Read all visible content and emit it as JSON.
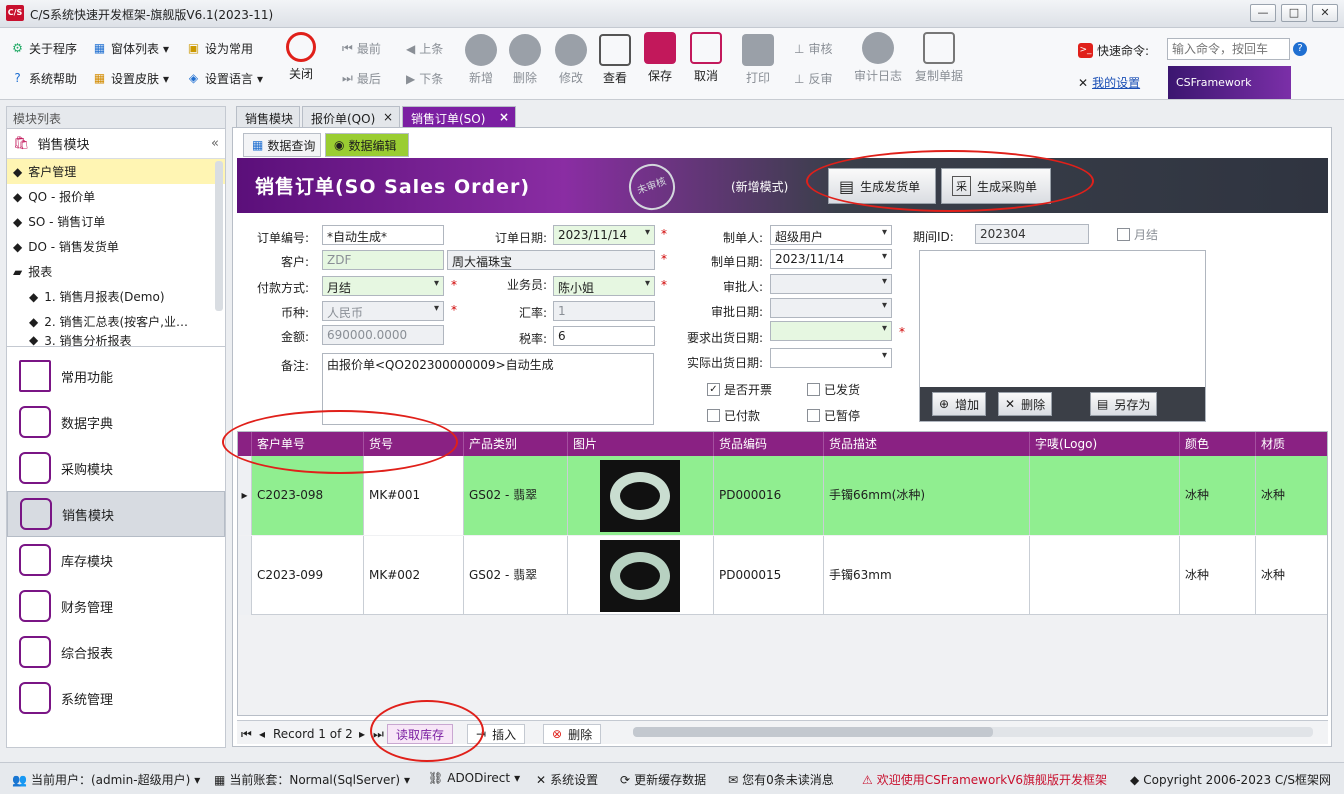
{
  "window": {
    "title": "C/S系统快速开发框架-旗舰版V6.1(2023-11)",
    "app_icon": "C/S",
    "minimize": "—",
    "maximize": "□",
    "close": "✕"
  },
  "ribbon": {
    "about": "关于程序",
    "window_list": "窗体列表",
    "set_common": "设为常用",
    "help": "系统帮助",
    "skin": "设置皮肤",
    "language": "设置语言",
    "close": "关闭",
    "first": "最前",
    "prev": "上条",
    "last": "最后",
    "next": "下条",
    "add": "新增",
    "delete": "删除",
    "modify": "修改",
    "view": "查看",
    "save": "保存",
    "cancel": "取消",
    "print": "打印",
    "approve": "审核",
    "unapprove": "反审",
    "audit_log": "审计日志",
    "copy": "复制单据",
    "quick_cmd_label": "快速命令:",
    "quick_cmd_placeholder": "输入命令，按回车",
    "my_settings": "我的设置",
    "logo_text": "CSFramework"
  },
  "sidebar": {
    "header": "模块列表",
    "module": "销售模块",
    "tree": [
      "客户管理",
      "QO - 报价单",
      "SO - 销售订单",
      "DO - 销售发货单",
      "报表",
      "1. 销售月报表(Demo)",
      "2. 销售汇总表(按客户,业…",
      "3. 销售分析报表"
    ],
    "nav": [
      "常用功能",
      "数据字典",
      "采购模块",
      "销售模块",
      "库存模块",
      "财务管理",
      "综合报表",
      "系统管理"
    ]
  },
  "tabs": [
    "销售模块",
    "报价单(QO)",
    "销售订单(SO)"
  ],
  "subtabs": [
    "数据查询",
    "数据编辑"
  ],
  "banner": {
    "title": "销售订单(SO Sales Order)",
    "stamp": "未审核",
    "mode": "(新增模式)",
    "btn_delivery": "生成发货单",
    "btn_purchase": "生成采购单",
    "btn_delivery_icon": "▤",
    "btn_purchase_icon": "采"
  },
  "form": {
    "order_no_label": "订单编号:",
    "order_no": "*自动生成*",
    "order_date_label": "订单日期:",
    "order_date": "2023/11/14",
    "maker_label": "制单人:",
    "maker": "超级用户",
    "period_label": "期间ID:",
    "period": "202304",
    "monthly_label": "月结",
    "customer_label": "客户:",
    "customer_code": "ZDF",
    "customer_name": "周大福珠宝",
    "make_date_label": "制单日期:",
    "make_date": "2023/11/14",
    "pay_label": "付款方式:",
    "pay": "月结",
    "sales_label": "业务员:",
    "sales": "陈小姐",
    "approver_label": "审批人:",
    "approver": "",
    "currency_label": "币种:",
    "currency": "人民币",
    "rate_label": "汇率:",
    "rate": "1",
    "approve_date_label": "审批日期:",
    "approve_date": "",
    "amount_label": "金额:",
    "amount": "690000.0000",
    "tax_label": "税率:",
    "tax": "6",
    "req_ship_label": "要求出货日期:",
    "req_ship": "",
    "act_ship_label": "实际出货日期:",
    "act_ship": "",
    "remark_label": "备注:",
    "remark": "由报价单<QO202300000009>自动生成",
    "invoice_label": "是否开票",
    "shipped_label": "已发货",
    "paid_label": "已付款",
    "paused_label": "已暂停",
    "attach_add": "增加",
    "attach_delete": "删除",
    "attach_saveas": "另存为"
  },
  "grid": {
    "columns": [
      "客户单号",
      "货号",
      "产品类别",
      "图片",
      "货品编码",
      "货品描述",
      "字唛(Logo)",
      "颜色",
      "材质"
    ],
    "rows": [
      {
        "cust_no": "C2023-098",
        "item_no": "MK#001",
        "category": "GS02 - 翡翠",
        "code": "PD000016",
        "desc": "手镯66mm(冰种)",
        "logo": "",
        "color": "冰种",
        "material": "冰种"
      },
      {
        "cust_no": "C2023-099",
        "item_no": "MK#002",
        "category": "GS02 - 翡翠",
        "code": "PD000015",
        "desc": "手镯63mm",
        "logo": "",
        "color": "冰种",
        "material": "冰种"
      }
    ]
  },
  "navbar": {
    "record": "Record 1 of 2",
    "read_stock": "读取库存",
    "insert": "插入",
    "delete": "删除"
  },
  "status": {
    "user": "当前用户：(admin-超级用户)",
    "account": "当前账套：Normal(SqlServer)",
    "conn": "ADODirect",
    "settings": "系统设置",
    "refresh": "更新缓存数据",
    "messages": "您有0条未读消息",
    "welcome": "欢迎使用CSFrameworkV6旗舰版开发框架",
    "copyright": "Copyright 2006-2023 C/S框架网"
  },
  "colors": {
    "accent": "#7b1fa2",
    "grid_header": "#8a2183",
    "row_selected": "#90ee90",
    "annotation": "#e0201a"
  }
}
